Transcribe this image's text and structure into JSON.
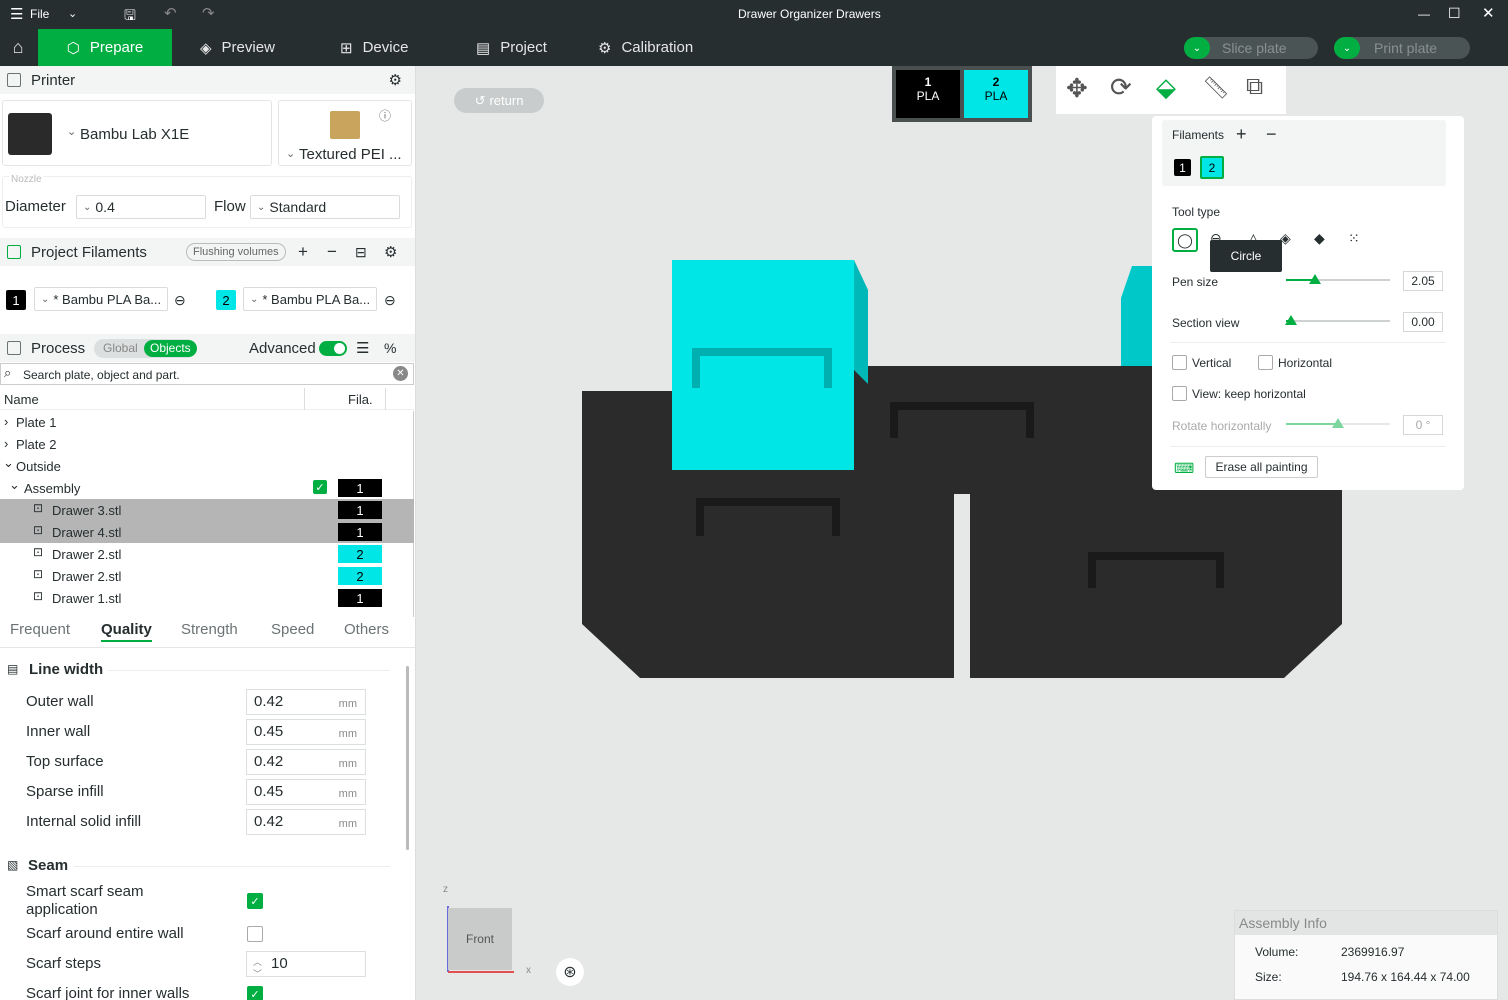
{
  "titlebar": {
    "menu_label": "File",
    "title": "Drawer Organizer Drawers"
  },
  "nav": {
    "home_icon": "home-icon",
    "tabs": [
      {
        "label": "Prepare",
        "icon": "cube-icon"
      },
      {
        "label": "Preview",
        "icon": "layers-icon"
      },
      {
        "label": "Device",
        "icon": "device-icon"
      },
      {
        "label": "Project",
        "icon": "project-icon"
      },
      {
        "label": "Calibration",
        "icon": "calibration-icon"
      }
    ],
    "slice_label": "Slice plate",
    "print_label": "Print plate"
  },
  "printer": {
    "section_title": "Printer",
    "printer_name": "Bambu Lab X1E",
    "plate_name": "Textured PEI ...",
    "nozzle_label": "Nozzle",
    "diameter_label": "Diameter",
    "diameter_value": "0.4",
    "flow_label": "Flow",
    "flow_value": "Standard"
  },
  "filaments": {
    "section_title": "Project Filaments",
    "flushing_label": "Flushing volumes",
    "items": [
      {
        "num": "1",
        "name": "* Bambu PLA Ba...",
        "color": "#000000"
      },
      {
        "num": "2",
        "name": "* Bambu PLA Ba...",
        "color": "#00e5e5"
      }
    ]
  },
  "process": {
    "section_title": "Process",
    "global_label": "Global",
    "objects_label": "Objects",
    "advanced_label": "Advanced",
    "search_placeholder": "Search plate, object and part.",
    "col_name": "Name",
    "col_fila": "Fila.",
    "tree": [
      {
        "label": "Plate 1",
        "expander": "›"
      },
      {
        "label": "Plate 2",
        "expander": "›"
      },
      {
        "label": "Outside",
        "expander": "⌄"
      },
      {
        "label": "Assembly",
        "expander": "⌄",
        "fila": "1"
      },
      {
        "label": "Drawer 3.stl",
        "fila": "1"
      },
      {
        "label": "Drawer 4.stl",
        "fila": "1"
      },
      {
        "label": "Drawer 2.stl",
        "fila": "2"
      },
      {
        "label": "Drawer 2.stl",
        "fila": "2"
      },
      {
        "label": "Drawer 1.stl",
        "fila": "1"
      }
    ],
    "tabs": [
      "Frequent",
      "Quality",
      "Strength",
      "Speed",
      "Others"
    ],
    "line_width_title": "Line width",
    "params": [
      {
        "label": "Outer wall",
        "value": "0.42",
        "unit": "mm"
      },
      {
        "label": "Inner wall",
        "value": "0.45",
        "unit": "mm"
      },
      {
        "label": "Top surface",
        "value": "0.42",
        "unit": "mm"
      },
      {
        "label": "Sparse infill",
        "value": "0.45",
        "unit": "mm"
      },
      {
        "label": "Internal solid infill",
        "value": "0.42",
        "unit": "mm"
      }
    ],
    "seam_title": "Seam",
    "seam": {
      "smart_scarf_line1": "Smart scarf seam",
      "smart_scarf_line2": "application",
      "scarf_entire_wall": "Scarf around entire wall",
      "scarf_steps_label": "Scarf steps",
      "scarf_steps_value": "10",
      "scarf_inner": "Scarf joint for inner walls"
    }
  },
  "canvas": {
    "return_label": "return",
    "filament_tabs": [
      {
        "num": "1",
        "type": "PLA",
        "color": "#000000"
      },
      {
        "num": "2",
        "type": "PLA",
        "color": "#00e5e5"
      }
    ],
    "view_label": "Front",
    "axis_z": "z",
    "axis_x": "x"
  },
  "paint_panel": {
    "filaments_label": "Filaments",
    "filament_swatches": [
      "1",
      "2"
    ],
    "tool_type_label": "Tool type",
    "tooltip": "Circle",
    "pen_size_label": "Pen size",
    "pen_size_value": "2.05",
    "pen_size_fraction": 0.28,
    "section_view_label": "Section view",
    "section_view_value": "0.00",
    "section_view_fraction": 0.05,
    "vertical_label": "Vertical",
    "horizontal_label": "Horizontal",
    "keep_horizontal_label": "View: keep horizontal",
    "rotate_label": "Rotate horizontally",
    "rotate_value": "0 °",
    "rotate_fraction": 0.5,
    "erase_label": "Erase all painting"
  },
  "assembly_info": {
    "title": "Assembly Info",
    "volume_label": "Volume:",
    "volume_value": "2369916.97",
    "size_label": "Size:",
    "size_value": "194.76 x 164.44 x 74.00"
  },
  "colors": {
    "accent": "#00ae42",
    "dark": "#262e30",
    "cyan": "#00e5e5",
    "model": "#2b2b2b"
  }
}
